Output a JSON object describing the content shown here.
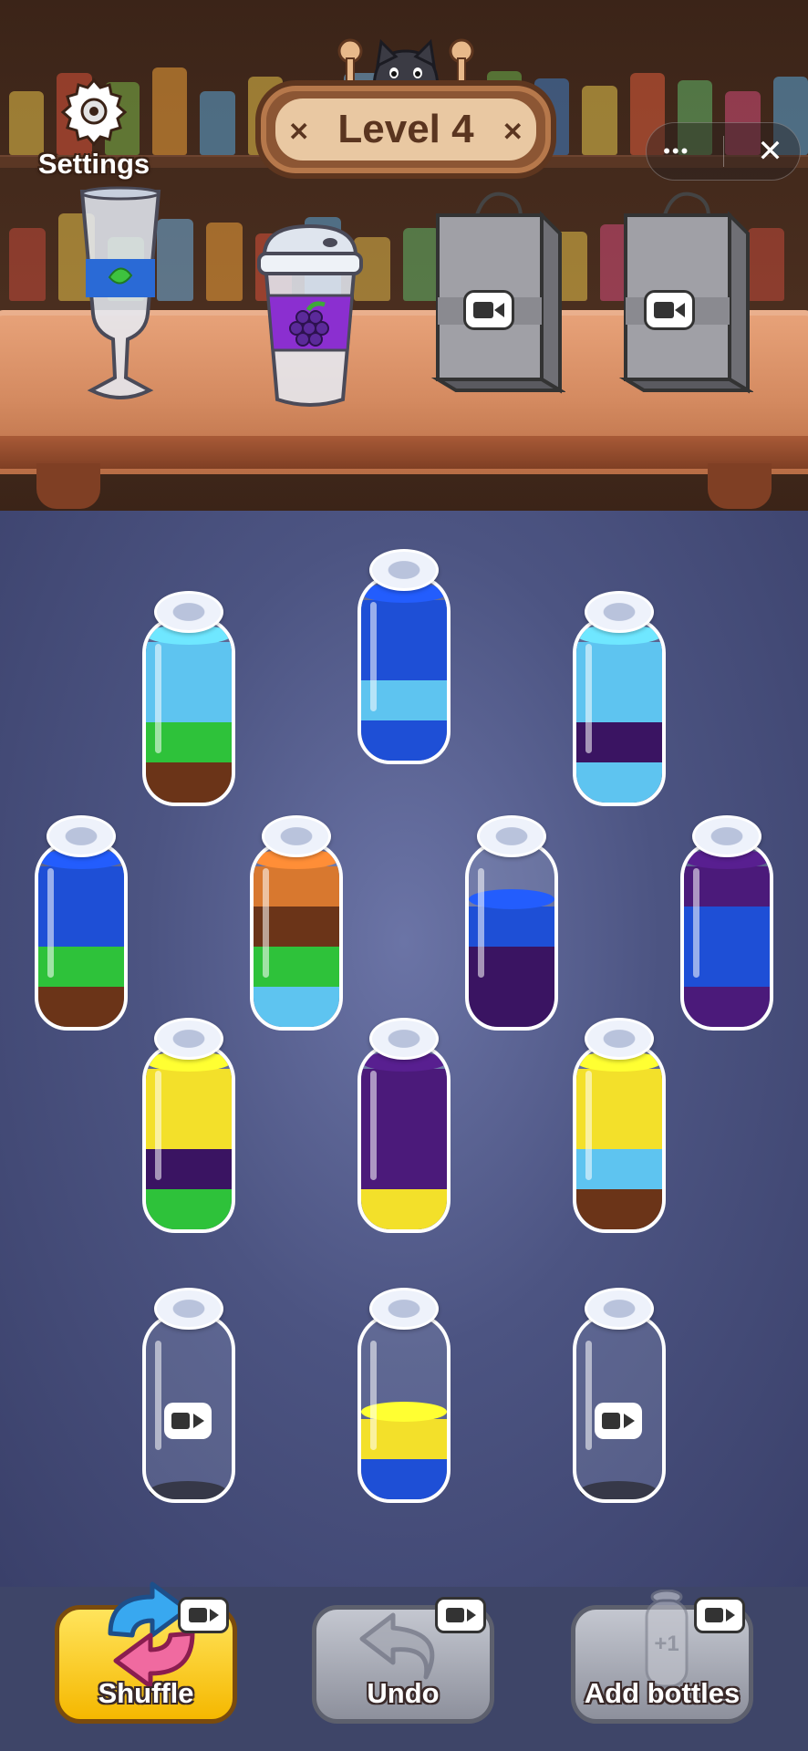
{
  "header": {
    "settings_label": "Settings",
    "level_label": "Level 4",
    "close_glyph": "✕",
    "more_glyph": "•••"
  },
  "colors": {
    "light_blue": "#5ec4f0",
    "green": "#2ec23a",
    "brown": "#6b3418",
    "blue": "#1e4fd6",
    "purple": "#3a1462",
    "violet": "#4b1a7a",
    "orange": "#d8782f",
    "yellow": "#f3e02a"
  },
  "collection": [
    {
      "name": "leaf-smoothie-glass",
      "locked": false
    },
    {
      "name": "grape-coffee-cup",
      "locked": false
    },
    {
      "name": "shopping-bag-1",
      "locked": true
    },
    {
      "name": "shopping-bag-2",
      "locked": true
    }
  ],
  "bottles": [
    {
      "id": "b1",
      "layers_bottom_to_top": [
        "brown",
        "green",
        "light_blue",
        "light_blue"
      ],
      "video_locked": false
    },
    {
      "id": "b2",
      "layers_bottom_to_top": [
        "blue",
        "light_blue",
        "blue",
        "blue"
      ],
      "video_locked": false
    },
    {
      "id": "b3",
      "layers_bottom_to_top": [
        "light_blue",
        "purple",
        "light_blue",
        "light_blue"
      ],
      "video_locked": false
    },
    {
      "id": "b4",
      "layers_bottom_to_top": [
        "brown",
        "green",
        "blue",
        "blue"
      ],
      "video_locked": false
    },
    {
      "id": "b5",
      "layers_bottom_to_top": [
        "light_blue",
        "green",
        "brown",
        "orange"
      ],
      "video_locked": false
    },
    {
      "id": "b6",
      "layers_bottom_to_top": [
        "purple",
        "purple",
        "blue"
      ],
      "video_locked": false
    },
    {
      "id": "b7",
      "layers_bottom_to_top": [
        "violet",
        "blue",
        "blue",
        "violet"
      ],
      "video_locked": false
    },
    {
      "id": "b8",
      "layers_bottom_to_top": [
        "green",
        "purple",
        "yellow",
        "yellow"
      ],
      "video_locked": false
    },
    {
      "id": "b9",
      "layers_bottom_to_top": [
        "yellow",
        "violet",
        "violet",
        "violet"
      ],
      "video_locked": false
    },
    {
      "id": "b10",
      "layers_bottom_to_top": [
        "brown",
        "light_blue",
        "yellow",
        "yellow"
      ],
      "video_locked": false
    },
    {
      "id": "b11",
      "layers_bottom_to_top": [],
      "video_locked": true
    },
    {
      "id": "b12",
      "layers_bottom_to_top": [
        "blue",
        "yellow"
      ],
      "video_locked": false
    },
    {
      "id": "b13",
      "layers_bottom_to_top": [],
      "video_locked": true
    }
  ],
  "actions": {
    "shuffle_label": "Shuffle",
    "undo_label": "Undo",
    "add_label": "Add bottles",
    "add_badge": "+1"
  }
}
